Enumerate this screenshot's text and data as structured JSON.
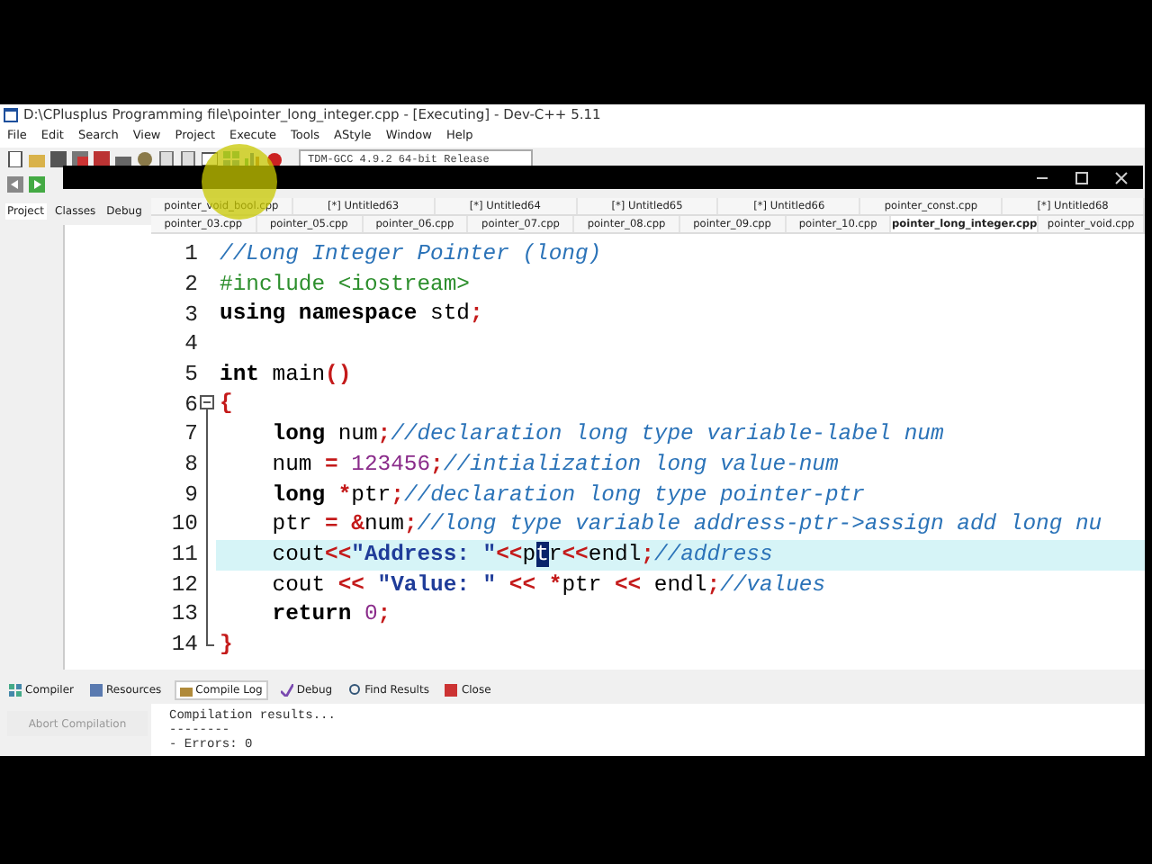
{
  "window": {
    "title": "D:\\CPlusplus Programming file\\pointer_long_integer.cpp - [Executing] - Dev-C++ 5.11"
  },
  "menu": [
    "File",
    "Edit",
    "Search",
    "View",
    "Project",
    "Execute",
    "Tools",
    "AStyle",
    "Window",
    "Help"
  ],
  "toolbar": {
    "compiler": "TDM-GCC 4.9.2 64-bit Release"
  },
  "left_panel": {
    "tabs": [
      {
        "label": "Project",
        "selected": true
      },
      {
        "label": "Classes",
        "selected": false
      },
      {
        "label": "Debug",
        "selected": false
      }
    ]
  },
  "editor_tabs": [
    [
      {
        "label": "pointer_void_bool.cpp",
        "selected": false
      },
      {
        "label": "[*] Untitled63",
        "selected": false
      },
      {
        "label": "[*] Untitled64",
        "selected": false
      },
      {
        "label": "[*] Untitled65",
        "selected": false
      },
      {
        "label": "[*] Untitled66",
        "selected": false
      },
      {
        "label": "pointer_const.cpp",
        "selected": false
      },
      {
        "label": "[*] Untitled68",
        "selected": false
      }
    ],
    [
      {
        "label": "pointer_03.cpp",
        "selected": false
      },
      {
        "label": "pointer_05.cpp",
        "selected": false
      },
      {
        "label": "pointer_06.cpp",
        "selected": false
      },
      {
        "label": "pointer_07.cpp",
        "selected": false
      },
      {
        "label": "pointer_08.cpp",
        "selected": false
      },
      {
        "label": "pointer_09.cpp",
        "selected": false
      },
      {
        "label": "pointer_10.cpp",
        "selected": false
      },
      {
        "label": "pointer_long_integer.cpp",
        "selected": true
      },
      {
        "label": "pointer_void.cpp",
        "selected": false
      }
    ]
  ],
  "code": [
    {
      "number": "1",
      "tokens": [
        {
          "kind": "comment",
          "text": "//Long Integer Pointer (long)"
        }
      ]
    },
    {
      "number": "2",
      "tokens": [
        {
          "kind": "pre",
          "text": "#include <iostream>"
        }
      ]
    },
    {
      "number": "3",
      "tokens": [
        {
          "kind": "kw",
          "text": "using namespace"
        },
        {
          "kind": "plain",
          "text": " std"
        },
        {
          "kind": "op",
          "text": ";"
        }
      ]
    },
    {
      "number": "4"
    },
    {
      "number": "5",
      "tokens": [
        {
          "kind": "kw",
          "text": "int"
        },
        {
          "kind": "plain",
          "text": " main"
        },
        {
          "kind": "op",
          "text": "()"
        }
      ]
    },
    {
      "number": "6",
      "kind": "fold_start",
      "tokens": [
        {
          "kind": "op",
          "text": "{"
        }
      ]
    },
    {
      "number": "7",
      "kind": "fold_body",
      "tokens": [
        {
          "kind": "kw",
          "text": "    long"
        },
        {
          "kind": "plain",
          "text": " num"
        },
        {
          "kind": "op",
          "text": ";"
        },
        {
          "kind": "comment",
          "text": "//declaration long type variable-label num"
        }
      ]
    },
    {
      "number": "8",
      "kind": "fold_body",
      "tokens": [
        {
          "kind": "plain",
          "text": "    num "
        },
        {
          "kind": "op",
          "text": "="
        },
        {
          "kind": "num",
          "text": " 123456"
        },
        {
          "kind": "op",
          "text": ";"
        },
        {
          "kind": "comment",
          "text": "//intialization long value-num"
        }
      ]
    },
    {
      "number": "9",
      "kind": "fold_body",
      "tokens": [
        {
          "kind": "kw",
          "text": "    long"
        },
        {
          "kind": "op",
          "text": " *"
        },
        {
          "kind": "plain",
          "text": "ptr"
        },
        {
          "kind": "op",
          "text": ";"
        },
        {
          "kind": "comment",
          "text": "//declaration long type pointer-ptr"
        }
      ]
    },
    {
      "number": "10",
      "kind": "fold_body",
      "tokens": [
        {
          "kind": "plain",
          "text": "    ptr "
        },
        {
          "kind": "op",
          "text": "="
        },
        {
          "kind": "op",
          "text": " &"
        },
        {
          "kind": "plain",
          "text": "num"
        },
        {
          "kind": "op",
          "text": ";"
        },
        {
          "kind": "comment",
          "text": "//long type variable address-ptr->assign add long nu"
        }
      ]
    },
    {
      "number": "11",
      "current": true,
      "kind": "fold_body",
      "tokens": [
        {
          "kind": "plain",
          "text": "    cout"
        },
        {
          "kind": "op",
          "text": "<<"
        },
        {
          "kind": "str",
          "text": "\"Address: \""
        },
        {
          "kind": "op",
          "text": "<<"
        },
        {
          "kind": "plain",
          "text": "p"
        },
        {
          "kind": "sel",
          "text": "t"
        },
        {
          "kind": "plain",
          "text": "r"
        },
        {
          "kind": "op",
          "text": "<<"
        },
        {
          "kind": "plain",
          "text": "endl"
        },
        {
          "kind": "op",
          "text": ";"
        },
        {
          "kind": "comment",
          "text": "//address"
        }
      ]
    },
    {
      "number": "12",
      "kind": "fold_body",
      "tokens": [
        {
          "kind": "plain",
          "text": "    cout "
        },
        {
          "kind": "op",
          "text": "<<"
        },
        {
          "kind": "str",
          "text": " \"Value: \""
        },
        {
          "kind": "op",
          "text": " <<"
        },
        {
          "kind": "op",
          "text": " *"
        },
        {
          "kind": "plain",
          "text": "ptr "
        },
        {
          "kind": "op",
          "text": "<<"
        },
        {
          "kind": "plain",
          "text": " endl"
        },
        {
          "kind": "op",
          "text": ";"
        },
        {
          "kind": "comment",
          "text": "//values"
        }
      ]
    },
    {
      "number": "13",
      "kind": "fold_body",
      "tokens": [
        {
          "kind": "kw",
          "text": "    return"
        },
        {
          "kind": "num",
          "text": " 0"
        },
        {
          "kind": "op",
          "text": ";"
        }
      ]
    },
    {
      "number": "14",
      "kind": "fold_end",
      "tokens": [
        {
          "kind": "op",
          "text": "}"
        }
      ]
    }
  ],
  "bottom_tabs": [
    {
      "label": "Compiler",
      "selected": false
    },
    {
      "label": "Resources",
      "selected": false
    },
    {
      "label": "Compile Log",
      "selected": true
    },
    {
      "label": "Debug",
      "selected": false
    },
    {
      "label": "Find Results",
      "selected": false
    },
    {
      "label": "Close",
      "selected": false
    }
  ],
  "compile_log": {
    "abort_button": {
      "label": "Abort Compilation",
      "disabled": true
    },
    "lines": [
      "Compilation results...",
      "--------",
      "- Errors: 0"
    ]
  }
}
